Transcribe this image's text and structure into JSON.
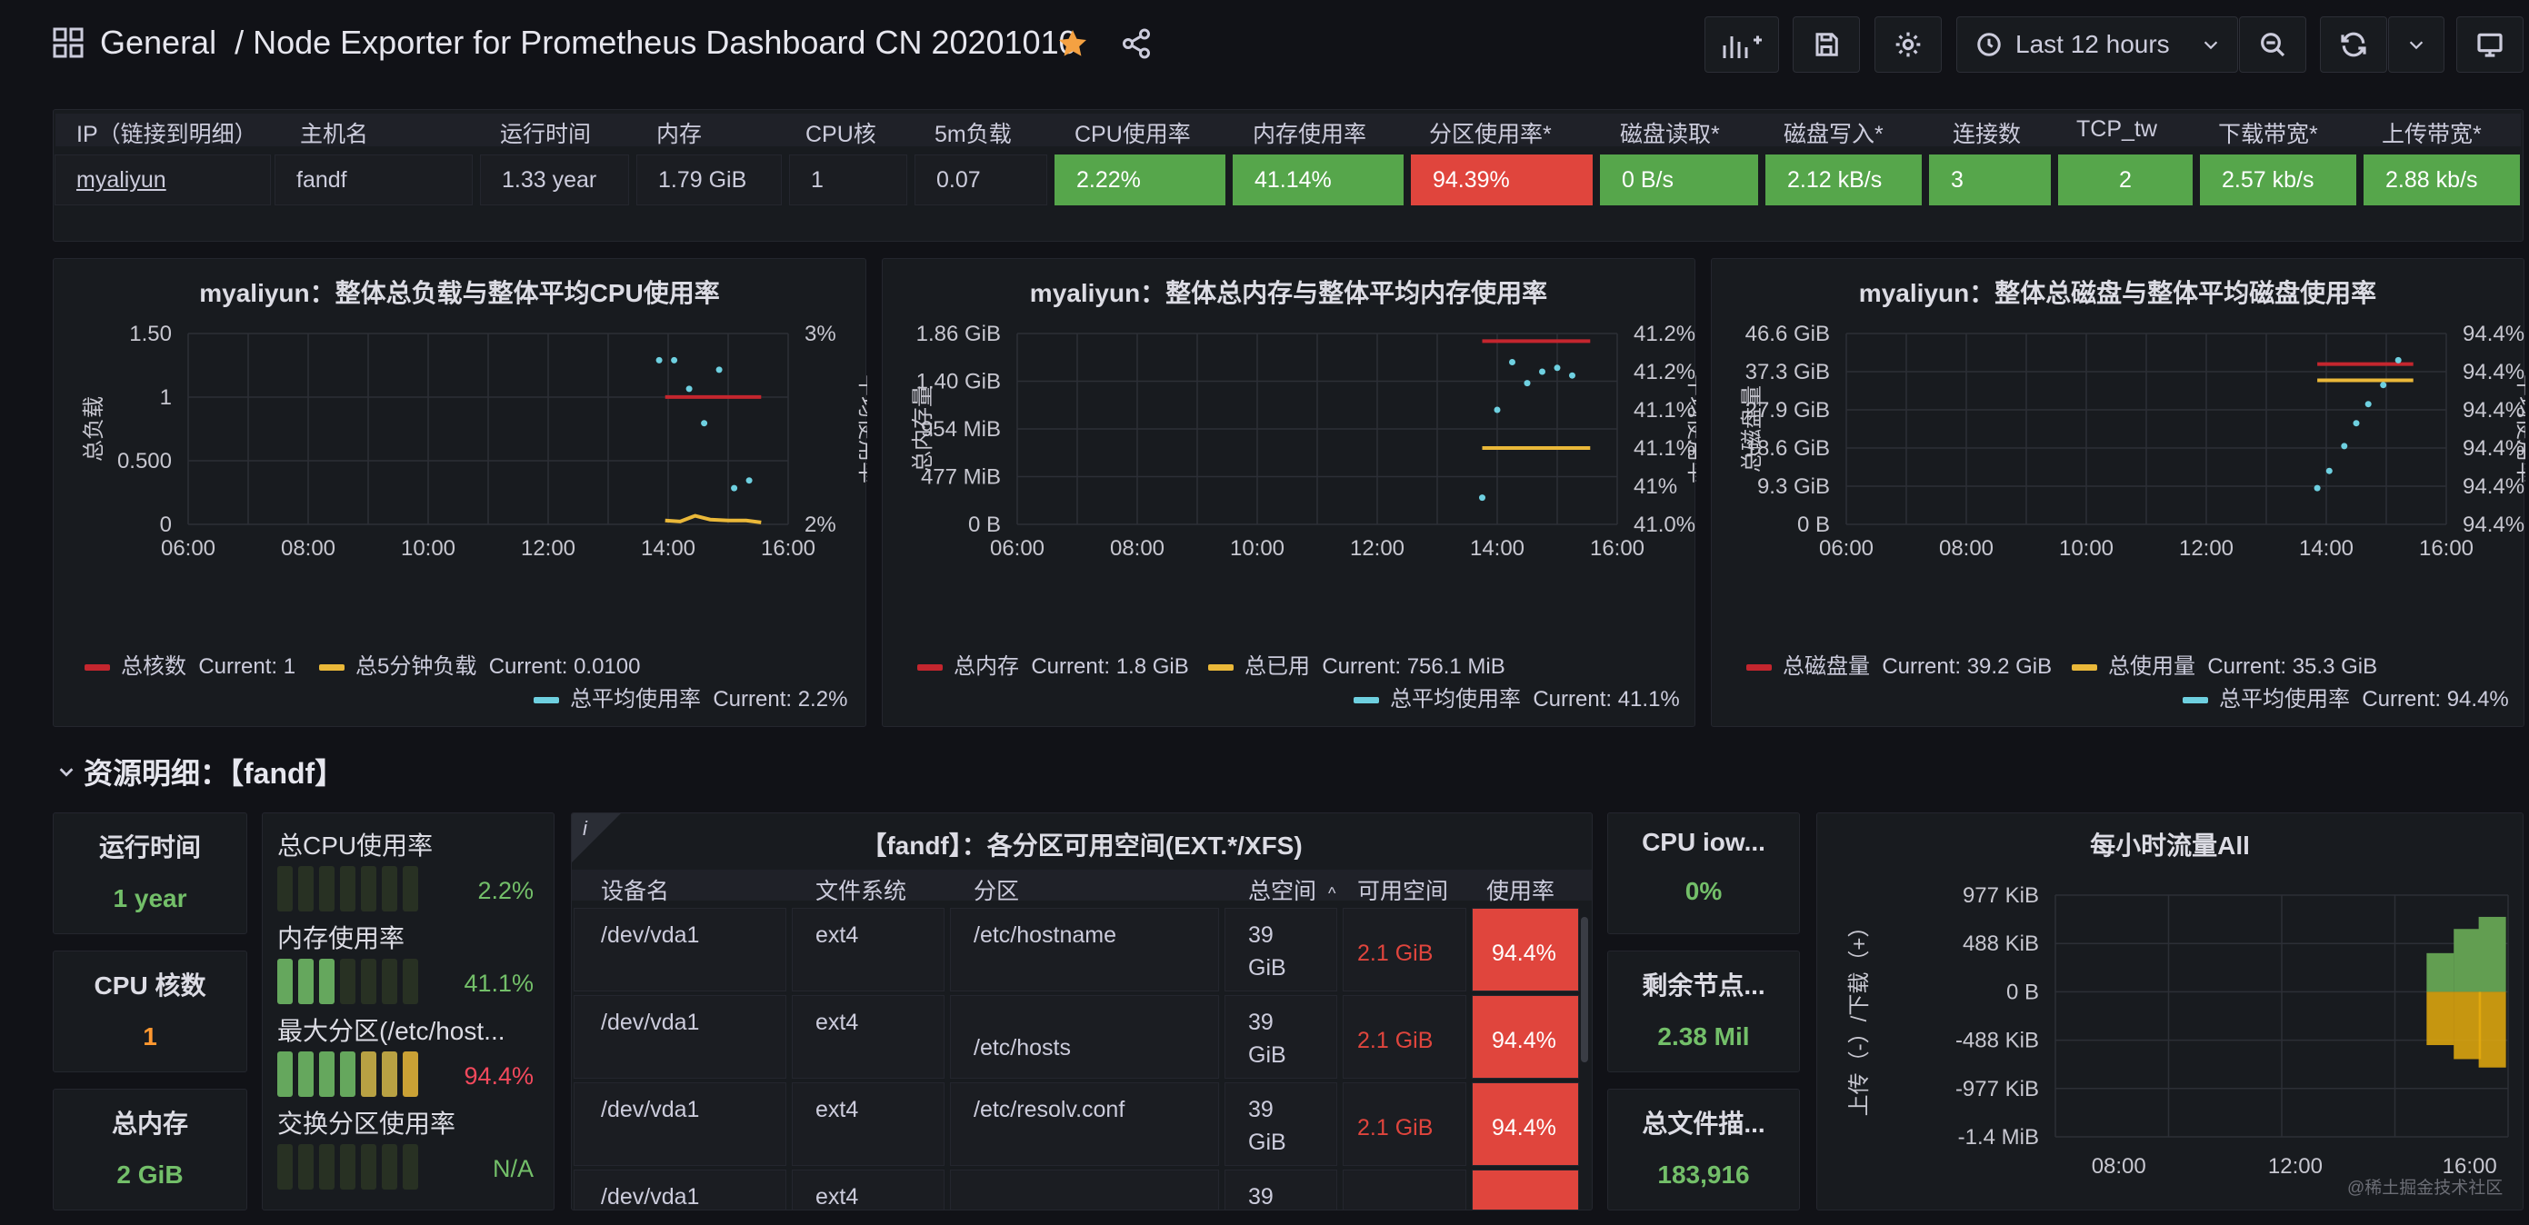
{
  "header": {
    "breadcrumb": "General",
    "title": "/ Node Exporter for Prometheus Dashboard CN 20201010",
    "time_range": "Last 12 hours"
  },
  "overview": {
    "columns": [
      "IP（链接到明细）",
      "主机名",
      "运行时间",
      "内存",
      "CPU核",
      "5m负载",
      "CPU使用率",
      "内存使用率",
      "分区使用率*",
      "磁盘读取*",
      "磁盘写入*",
      "连接数",
      "TCP_tw",
      "下载带宽*",
      "上传带宽*"
    ],
    "row": [
      "myaliyun",
      "fandf",
      "1.33 year",
      "1.79 GiB",
      "1",
      "0.07",
      "2.22%",
      "41.14%",
      "94.39%",
      "0 B/s",
      "2.12 kB/s",
      "3",
      "2",
      "2.57 kb/s",
      "2.88 kb/s"
    ],
    "colors": {
      "green": "#56a64b",
      "red": "#e0453d"
    }
  },
  "cpu_panel": {
    "title": "myaliyun：整体总负载与整体平均CPU使用率",
    "ylabel_left": "总负载",
    "ylabel_right": "平均使用率",
    "yticks_left": [
      "1.50",
      "1",
      "0.500",
      "0"
    ],
    "yticks_right": [
      "3%",
      "2%"
    ],
    "xticks": [
      "06:00",
      "08:00",
      "10:00",
      "12:00",
      "14:00",
      "16:00"
    ],
    "legend": [
      {
        "name": "总核数",
        "current": "Current: 1",
        "color": "#c4262e"
      },
      {
        "name": "总5分钟负载",
        "current": "Current: 0.0100",
        "color": "#eab839"
      },
      {
        "name": "总平均使用率",
        "current": "Current: 2.2%",
        "color": "#6ed0e0"
      }
    ]
  },
  "mem_panel": {
    "title": "myaliyun：整体总内存与整体平均内存使用率",
    "ylabel_left": "总内存量",
    "ylabel_right": "平均使用率",
    "yticks_left": [
      "1.86 GiB",
      "1.40 GiB",
      "954 MiB",
      "477 MiB",
      "0 B"
    ],
    "yticks_right": [
      "41.2%",
      "41.2%",
      "41.1%",
      "41.1%",
      "41%",
      "41.0%"
    ],
    "xticks": [
      "06:00",
      "08:00",
      "10:00",
      "12:00",
      "14:00",
      "16:00"
    ],
    "legend": [
      {
        "name": "总内存",
        "current": "Current: 1.8 GiB",
        "color": "#c4262e"
      },
      {
        "name": "总已用",
        "current": "Current: 756.1 MiB",
        "color": "#eab839"
      },
      {
        "name": "总平均使用率",
        "current": "Current: 41.1%",
        "color": "#6ed0e0"
      }
    ]
  },
  "disk_panel": {
    "title": "myaliyun：整体总磁盘与整体平均磁盘使用率",
    "ylabel_left": "总磁盘量",
    "ylabel_right": "平均使用率",
    "yticks_left": [
      "46.6 GiB",
      "37.3 GiB",
      "27.9 GiB",
      "18.6 GiB",
      "9.3 GiB",
      "0 B"
    ],
    "yticks_right": [
      "94.4%",
      "94.4%",
      "94.4%",
      "94.4%",
      "94.4%",
      "94.4%"
    ],
    "xticks": [
      "06:00",
      "08:00",
      "10:00",
      "12:00",
      "14:00",
      "16:00"
    ],
    "legend": [
      {
        "name": "总磁盘量",
        "current": "Current: 39.2 GiB",
        "color": "#c4262e"
      },
      {
        "name": "总使用量",
        "current": "Current: 35.3 GiB",
        "color": "#eab839"
      },
      {
        "name": "总平均使用率",
        "current": "Current: 94.4%",
        "color": "#6ed0e0"
      }
    ]
  },
  "section": {
    "title": "资源明细：【fandf】"
  },
  "stats": {
    "uptime": {
      "title": "运行时间",
      "value": "1 year"
    },
    "cpu_cores": {
      "title": "CPU 核数",
      "value": "1"
    },
    "total_mem": {
      "title": "总内存",
      "value": "2 GiB"
    },
    "cpu_iowait": {
      "title": "CPU iow...",
      "value": "0%"
    },
    "inodes": {
      "title": "剩余节点...",
      "value": "2.38 Mil"
    },
    "fds": {
      "title": "总文件描...",
      "value": "183,916"
    }
  },
  "bargauge": {
    "items": [
      {
        "label": "总CPU使用率",
        "value": "2.2%",
        "fraction": 0.022,
        "color": "#73bf69"
      },
      {
        "label": "内存使用率",
        "value": "41.1%",
        "fraction": 0.411,
        "color": "#73bf69"
      },
      {
        "label": "最大分区(/etc/host...",
        "value": "94.4%",
        "fraction": 0.944,
        "color": "#f2495c"
      },
      {
        "label": "交换分区使用率",
        "value": "N/A",
        "fraction": 0,
        "color": "#73bf69"
      }
    ]
  },
  "fs_table": {
    "title": "【fandf】：各分区可用空间(EXT.*/XFS)",
    "info": "i",
    "columns": [
      "设备名",
      "文件系统",
      "分区",
      "总空间",
      "可用空间",
      "使用率"
    ],
    "sort_indicator": "^",
    "rows": [
      {
        "device": "/dev/vda1",
        "fs": "ext4",
        "mount": "/etc/hostname",
        "size1": "39",
        "size2": "GiB",
        "avail": "2.1 GiB",
        "used": "94.4%"
      },
      {
        "device": "/dev/vda1",
        "fs": "ext4",
        "mount": "/etc/hosts",
        "size1": "39",
        "size2": "GiB",
        "avail": "2.1 GiB",
        "used": "94.4%"
      },
      {
        "device": "/dev/vda1",
        "fs": "ext4",
        "mount": "/etc/resolv.conf",
        "size1": "39",
        "size2": "GiB",
        "avail": "2.1 GiB",
        "used": "94.4%"
      },
      {
        "device": "/dev/vda1",
        "fs": "ext4",
        "mount": "",
        "size1": "39",
        "size2": "",
        "avail": "",
        "used": ""
      }
    ]
  },
  "traffic_panel": {
    "title": "每小时流量All",
    "ylabel": "上传（-）/下载（+）",
    "yticks": [
      "977 KiB",
      "488 KiB",
      "0 B",
      "-488 KiB",
      "-977 KiB",
      "-1.4 MiB"
    ],
    "xticks": [
      "08:00",
      "12:00",
      "16:00"
    ]
  },
  "watermark": "@稀土掘金技术社区"
}
